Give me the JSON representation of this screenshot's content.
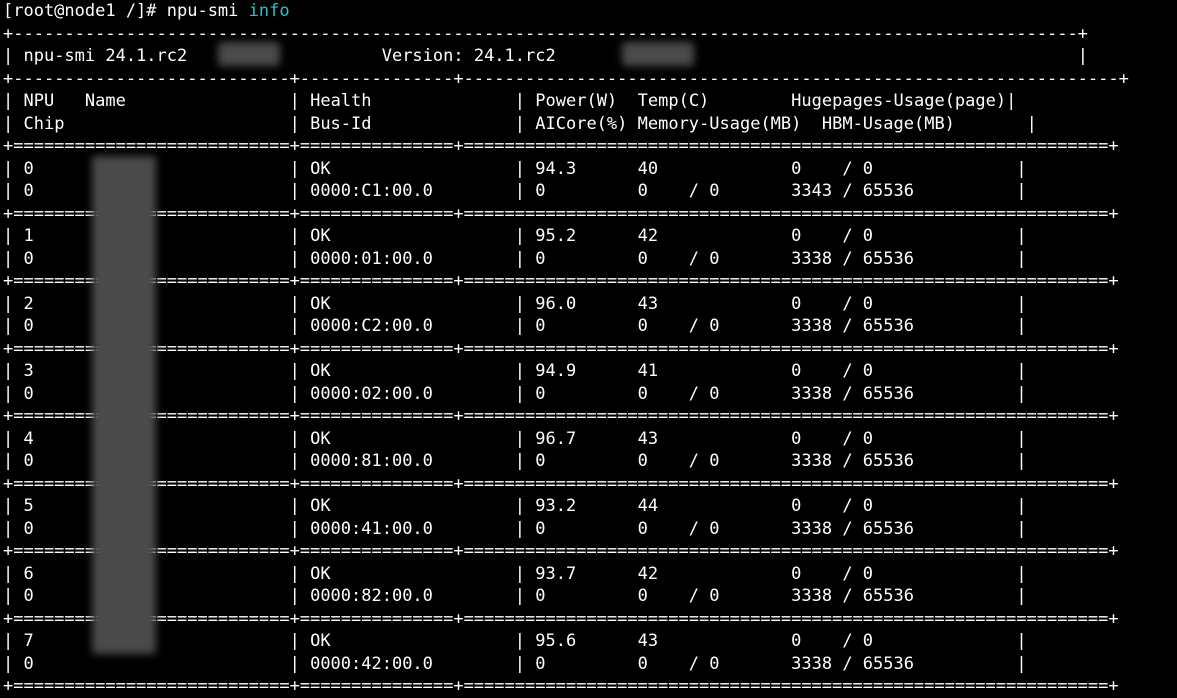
{
  "prompt": "[root@node1 /]# npu-smi ",
  "command_arg": "info",
  "header_left": "npu-smi 24.1.rc2",
  "header_version_label": "Version: 24.1.rc2",
  "columns": {
    "npu": "NPU",
    "name": "Name",
    "health": "Health",
    "power": "Power(W)",
    "temp": "Temp(C)",
    "hugepages": "Hugepages-Usage(page)",
    "chip": "Chip",
    "busid": "Bus-Id",
    "aicore": "AICore(%)",
    "memory": "Memory-Usage(MB)",
    "hbm": "HBM-Usage(MB)"
  },
  "devices": [
    {
      "npu": "0",
      "chip": "0",
      "health": "OK",
      "bus_id": "0000:C1:00.0",
      "power": "94.3",
      "aicore": "0",
      "temp": "40",
      "mem_used": "0",
      "mem_total": "0",
      "huge_used": "0",
      "huge_total": "0",
      "hbm_used": "3343",
      "hbm_total": "65536"
    },
    {
      "npu": "1",
      "chip": "0",
      "health": "OK",
      "bus_id": "0000:01:00.0",
      "power": "95.2",
      "aicore": "0",
      "temp": "42",
      "mem_used": "0",
      "mem_total": "0",
      "huge_used": "0",
      "huge_total": "0",
      "hbm_used": "3338",
      "hbm_total": "65536"
    },
    {
      "npu": "2",
      "chip": "0",
      "health": "OK",
      "bus_id": "0000:C2:00.0",
      "power": "96.0",
      "aicore": "0",
      "temp": "43",
      "mem_used": "0",
      "mem_total": "0",
      "huge_used": "0",
      "huge_total": "0",
      "hbm_used": "3338",
      "hbm_total": "65536"
    },
    {
      "npu": "3",
      "chip": "0",
      "health": "OK",
      "bus_id": "0000:02:00.0",
      "power": "94.9",
      "aicore": "0",
      "temp": "41",
      "mem_used": "0",
      "mem_total": "0",
      "huge_used": "0",
      "huge_total": "0",
      "hbm_used": "3338",
      "hbm_total": "65536"
    },
    {
      "npu": "4",
      "chip": "0",
      "health": "OK",
      "bus_id": "0000:81:00.0",
      "power": "96.7",
      "aicore": "0",
      "temp": "43",
      "mem_used": "0",
      "mem_total": "0",
      "huge_used": "0",
      "huge_total": "0",
      "hbm_used": "3338",
      "hbm_total": "65536"
    },
    {
      "npu": "5",
      "chip": "0",
      "health": "OK",
      "bus_id": "0000:41:00.0",
      "power": "93.2",
      "aicore": "0",
      "temp": "44",
      "mem_used": "0",
      "mem_total": "0",
      "huge_used": "0",
      "huge_total": "0",
      "hbm_used": "3338",
      "hbm_total": "65536"
    },
    {
      "npu": "6",
      "chip": "0",
      "health": "OK",
      "bus_id": "0000:82:00.0",
      "power": "93.7",
      "aicore": "0",
      "temp": "42",
      "mem_used": "0",
      "mem_total": "0",
      "huge_used": "0",
      "huge_total": "0",
      "hbm_used": "3338",
      "hbm_total": "65536"
    },
    {
      "npu": "7",
      "chip": "0",
      "health": "OK",
      "bus_id": "0000:42:00.0",
      "power": "95.6",
      "aicore": "0",
      "temp": "43",
      "mem_used": "0",
      "mem_total": "0",
      "huge_used": "0",
      "huge_total": "0",
      "hbm_used": "3338",
      "hbm_total": "65536"
    }
  ]
}
